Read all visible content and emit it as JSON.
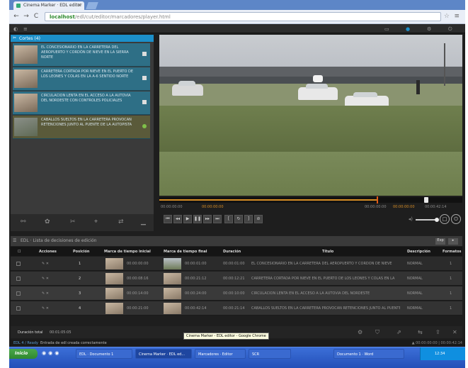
{
  "browser": {
    "tab_title": "Cinema Marker · EDL editor",
    "url_host": "localhost",
    "url_path": "/edl/cut/editor/marcadores/player.html",
    "back_label": "←",
    "forward_label": "→",
    "reload_label": "C",
    "star_label": "☆",
    "menu_label": "≡"
  },
  "left_panel": {
    "header": "Cortes (4)",
    "clips": [
      {
        "text": "EL CONCESIONARIO EN LA CARRETERA DEL AEROPUERTO Y CORDÓN DE NIEVE EN LA SIERRA NORTE"
      },
      {
        "text": "CARRETERA CORTADA POR NIEVE EN EL PUERTO DE LOS LEONES Y COLAS EN LA A-6 SENTIDO NORTE"
      },
      {
        "text": "CIRCULACIÓN LENTA EN EL ACCESO A LA AUTOVÍA DEL NORDESTE CON CONTROLES POLICIALES"
      },
      {
        "text": "CABALLOS SUELTOS EN LA CARRETERA PROVOCAN RETENCIONES JUNTO AL PUENTE DE LA AUTOPISTA"
      }
    ]
  },
  "player": {
    "tc_in_label": "00:00:00:00",
    "tc_in": "00:00:00:00",
    "tc_current_label": "00:00:00:00",
    "tc_out": "00:00:42:14",
    "progress_fraction": 0.88,
    "marker_fraction": 0.72,
    "volume_fraction": 0.7
  },
  "edl": {
    "title": "EDL · Lista de decisiones de edición",
    "buttons": [
      "Exp",
      "▸"
    ],
    "columns": [
      "Acciones",
      "Posición",
      "Marca de tiempo inicial",
      "Marca de tiempo final",
      "Duración",
      "Título",
      "Descripción",
      "Formatos"
    ],
    "rows": [
      {
        "pos": "1",
        "tin": "00:00:00:00",
        "tout": "00:00:01:00",
        "dur": "00:00:01:00",
        "title": "EL CONCESIONARIO EN LA CARRETERA DEL AEROPUERTO Y CORDÓN DE NIEVE",
        "desc": "NORMAL",
        "fmt": "1"
      },
      {
        "pos": "2",
        "tin": "00:00:08:16",
        "tout": "00:00:21:12",
        "dur": "00:00:12:21",
        "title": "CARRETERA CORTADA POR NIEVE EN EL PUERTO DE LOS LEONES Y COLAS EN LA",
        "desc": "NORMAL",
        "fmt": "1"
      },
      {
        "pos": "3",
        "tin": "00:00:14:00",
        "tout": "00:00:24:00",
        "dur": "00:00:10:00",
        "title": "CIRCULACIÓN LENTA EN EL ACCESO A LA AUTOVÍA DEL NORDESTE",
        "desc": "NORMAL",
        "fmt": "1"
      },
      {
        "pos": "4",
        "tin": "00:00:21:00",
        "tout": "00:00:42:14",
        "dur": "00:00:21:14",
        "title": "CABALLOS SUELTOS EN LA CARRETERA PROVOCAN RETENCIONES JUNTO AL PUENTE",
        "desc": "NORMAL",
        "fmt": "1"
      }
    ],
    "status_label": "Duración total",
    "status_value": "00:01:05:05"
  },
  "app_bottom": {
    "left": "EDL 4 / Ready",
    "message": "Entrada de edl creada correctamente",
    "right": "▲ 00:00:00:00 | 00:00:42:14"
  },
  "tooltip": "Cinema Marker - EDL editor - Google Chrome",
  "taskbar": {
    "start": "Inicio",
    "items": [
      "EDL · Documento 1",
      "Cinema Marker · EDL ed...",
      "Marcadores · Editor",
      "SCR",
      "Documento 1 · Word"
    ],
    "clock": "12:34"
  },
  "colors": {
    "accent_blue": "#1c8fc9",
    "timeline_orange": "#d58c25",
    "clip_teal": "#2e6f86"
  }
}
